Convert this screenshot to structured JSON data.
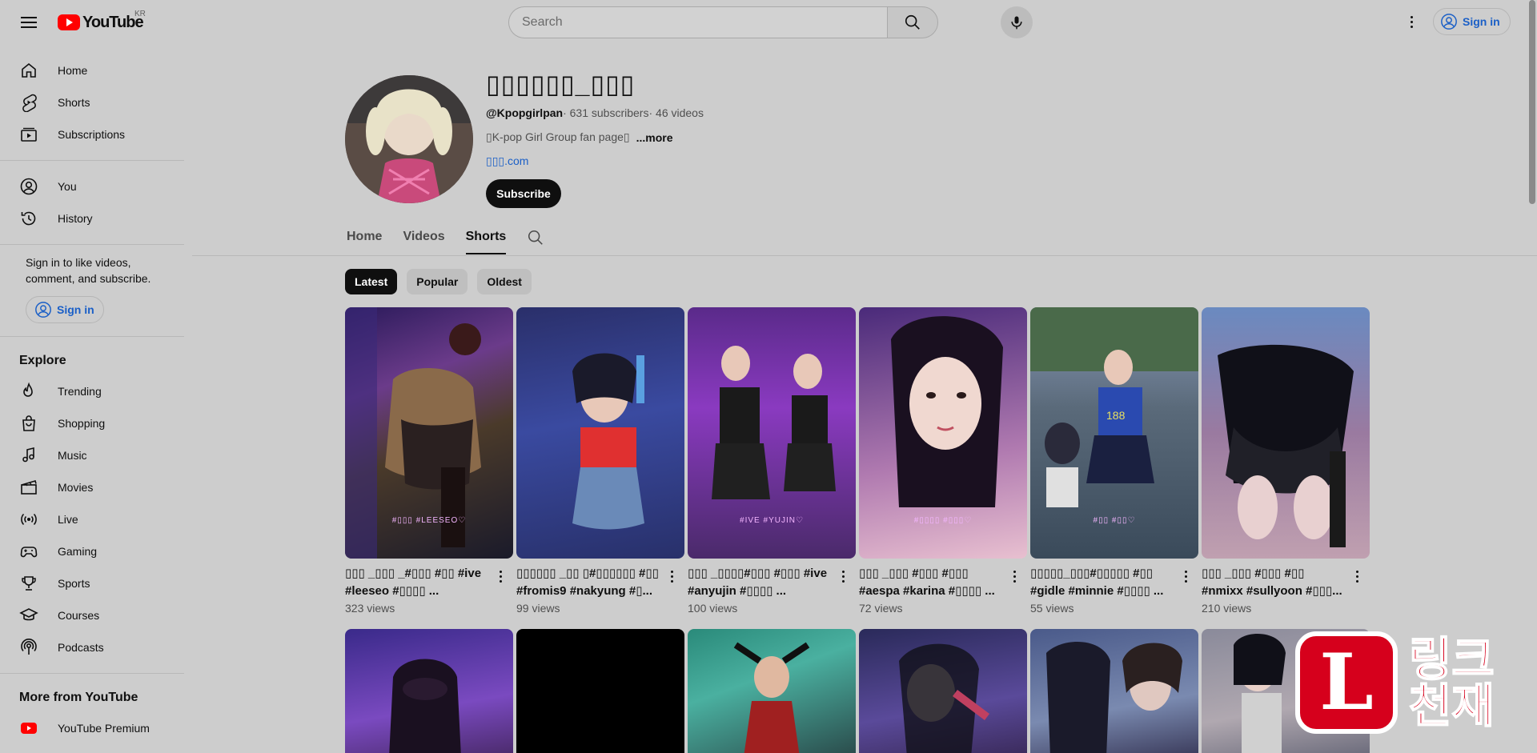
{
  "header": {
    "logo_text": "YouTube",
    "country_code": "KR",
    "search_placeholder": "Search",
    "sign_in_label": "Sign in"
  },
  "sidebar": {
    "main": [
      {
        "label": "Home",
        "icon": "home-icon"
      },
      {
        "label": "Shorts",
        "icon": "shorts-icon"
      },
      {
        "label": "Subscriptions",
        "icon": "subscriptions-icon"
      }
    ],
    "you": [
      {
        "label": "You",
        "icon": "user-icon"
      },
      {
        "label": "History",
        "icon": "history-icon"
      }
    ],
    "signin_note": "Sign in to like videos, comment, and subscribe.",
    "signin_label": "Sign in",
    "explore_title": "Explore",
    "explore": [
      {
        "label": "Trending",
        "icon": "trending-icon"
      },
      {
        "label": "Shopping",
        "icon": "shopping-bag-icon"
      },
      {
        "label": "Music",
        "icon": "music-note-icon"
      },
      {
        "label": "Movies",
        "icon": "clapperboard-icon"
      },
      {
        "label": "Live",
        "icon": "live-broadcast-icon"
      },
      {
        "label": "Gaming",
        "icon": "gamepad-icon"
      },
      {
        "label": "Sports",
        "icon": "trophy-icon"
      },
      {
        "label": "Courses",
        "icon": "graduation-cap-icon"
      },
      {
        "label": "Podcasts",
        "icon": "podcast-icon"
      }
    ],
    "more_title": "More from YouTube",
    "more": [
      {
        "label": "YouTube Premium",
        "icon": "youtube-premium-icon"
      }
    ]
  },
  "channel": {
    "title": "▯▯▯▯▯▯_▯▯▯",
    "handle": "@Kpopgirlpan",
    "subscribers": " · 631 subscribers",
    "videos": " · 46 videos",
    "description": "▯K-pop Girl Group fan page▯",
    "more_label": "...more",
    "link": "▯▯▯.com",
    "subscribe_label": "Subscribe"
  },
  "tabs": [
    {
      "label": "Home",
      "active": false
    },
    {
      "label": "Videos",
      "active": false
    },
    {
      "label": "Shorts",
      "active": true
    }
  ],
  "chips": [
    {
      "label": "Latest",
      "active": true
    },
    {
      "label": "Popular",
      "active": false
    },
    {
      "label": "Oldest",
      "active": false
    }
  ],
  "shorts_row1": [
    {
      "title": "▯▯▯ _▯▯▯ _#▯▯▯ #▯▯ #ive #leeseo #▯▯▯▯ ...",
      "views": "323 views",
      "caption": "#▯▯▯ #LEESEO♡"
    },
    {
      "title": "▯▯▯▯▯▯ _▯▯ ▯#▯▯▯▯▯▯ #▯▯ #fromis9 #nakyung #▯...",
      "views": "99 views",
      "caption": ""
    },
    {
      "title": "▯▯▯ _▯▯▯▯#▯▯▯ #▯▯▯ #ive #anyujin #▯▯▯▯ ...",
      "views": "100 views",
      "caption": "#IVE #YUJIN♡"
    },
    {
      "title": "▯▯▯ _▯▯▯ #▯▯▯ #▯▯▯ #aespa #karina #▯▯▯▯ ...",
      "views": "72 views",
      "caption": "#▯▯▯▯ #▯▯▯♡"
    },
    {
      "title": "▯▯▯▯▯_▯▯▯#▯▯▯▯▯ #▯▯ #gidle #minnie #▯▯▯▯ ...",
      "views": "55 views",
      "caption": "#▯▯ #▯▯♡"
    },
    {
      "title": "▯▯▯ _▯▯▯ #▯▯▯ #▯▯ #nmixx #sullyoon #▯▯▯...",
      "views": "210 views",
      "caption": ""
    }
  ],
  "shorts_row2": [
    {
      "id": "r2-1"
    },
    {
      "id": "r2-2"
    },
    {
      "id": "r2-3"
    },
    {
      "id": "r2-4"
    },
    {
      "id": "r2-5"
    },
    {
      "id": "r2-6"
    }
  ],
  "watermark": {
    "badge_letter": "L",
    "text_line1": "링크",
    "text_line2": "천재"
  },
  "colors": {
    "brand_red": "#ff0000",
    "link_blue": "#1a5fc7",
    "page_background": "#cdcdcd"
  }
}
